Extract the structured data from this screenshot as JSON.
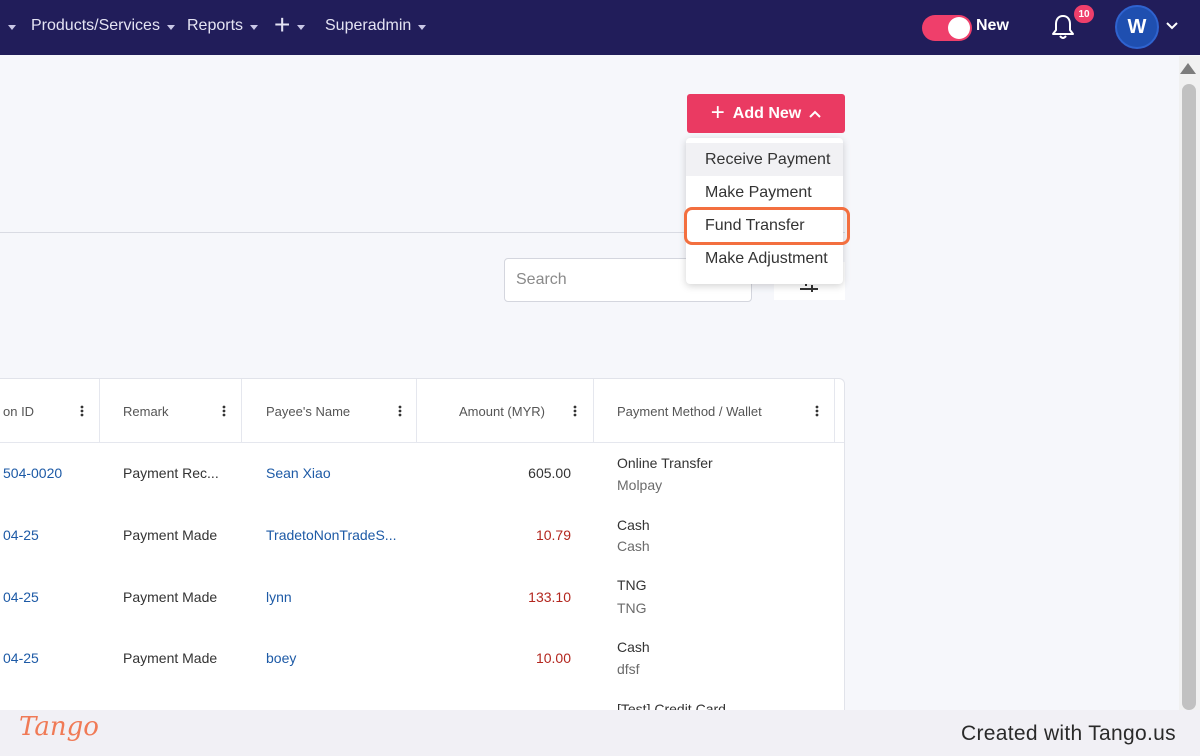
{
  "nav": {
    "items": [
      {
        "label": "Products/Services"
      },
      {
        "label": "Reports"
      },
      {
        "label": "+"
      },
      {
        "label": "Superadmin"
      }
    ],
    "toggle_label": "New",
    "notification_count": "10",
    "avatar_initial": "W",
    "icons": [
      "bell-icon",
      "chevron-down-icon",
      "plus-icon"
    ]
  },
  "actions": {
    "add_new_label": "Add New",
    "menu": [
      {
        "label": "Receive Payment"
      },
      {
        "label": "Make Payment"
      },
      {
        "label": "Fund Transfer"
      },
      {
        "label": "Make Adjustment"
      }
    ],
    "highlighted_item": "Fund Transfer"
  },
  "search": {
    "placeholder": "Search"
  },
  "table": {
    "columns": [
      {
        "label": "on ID"
      },
      {
        "label": "Remark"
      },
      {
        "label": "Payee's Name"
      },
      {
        "label": "Amount (MYR)"
      },
      {
        "label": "Payment Method / Wallet"
      }
    ],
    "rows": [
      {
        "id": "504-0020",
        "remark": "Payment Rec...",
        "payee": "Sean Xiao",
        "amount": "605.00",
        "negative": false,
        "method": "Online Transfer",
        "wallet": "Molpay"
      },
      {
        "id": "04-25",
        "remark": "Payment Made",
        "payee": "TradetoNonTradeS...",
        "amount": "10.79",
        "negative": true,
        "method": "Cash",
        "wallet": "Cash"
      },
      {
        "id": "04-25",
        "remark": "Payment Made",
        "payee": "lynn",
        "amount": "133.10",
        "negative": true,
        "method": "TNG",
        "wallet": "TNG"
      },
      {
        "id": "04-25",
        "remark": "Payment Made",
        "payee": "boey",
        "amount": "10.00",
        "negative": true,
        "method": "Cash",
        "wallet": "dfsf"
      },
      {
        "id": "",
        "remark": "",
        "payee": "",
        "amount": "",
        "negative": false,
        "method": "[Test] Credit Card",
        "wallet": ""
      }
    ]
  },
  "colors": {
    "nav_bg": "#211d5a",
    "accent": "#ea3a62",
    "link": "#1d5aa6",
    "negative": "#b3261e",
    "highlight": "#f36f3f"
  },
  "footer": {
    "logo": "Tango",
    "credit": "Created with Tango.us"
  }
}
